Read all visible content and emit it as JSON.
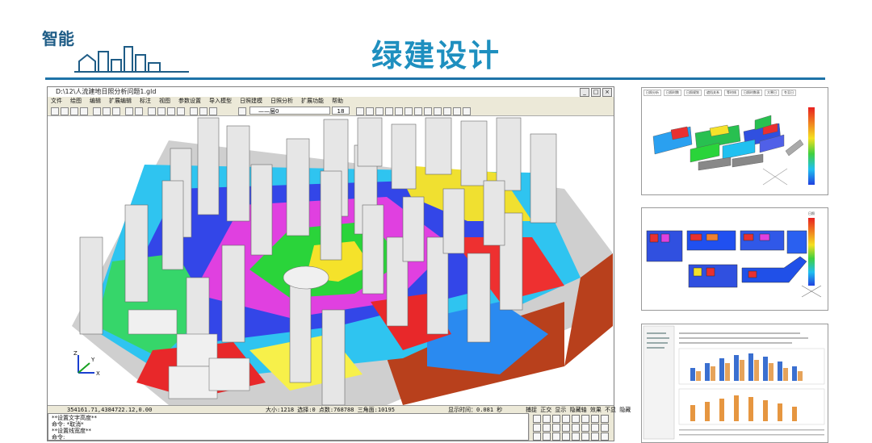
{
  "slide": {
    "title": "绿建设计",
    "logo_text": "智能"
  },
  "app": {
    "window_title": "D:\\12\\人流建地日照分析问题1.gld",
    "window_buttons": [
      "_",
      "□",
      "×"
    ],
    "menu": [
      "文件",
      "绘图",
      "编辑",
      "扩展编辑",
      "标注",
      "视图",
      "参数设置",
      "导入模型",
      "日照建模",
      "日照分析",
      "扩展功能",
      "帮助"
    ],
    "layer_combo": "——层0",
    "font_size": "18",
    "status": {
      "coords": "354161.71,4384722.12,0.00",
      "scale_info": "大小:1218 选择:0 点数:768788 三角面:10195",
      "display_time": "显示时间：0.081 秒",
      "modes": "捕捉 正交 显示 隐藏轴 效果 不显 隐藏"
    },
    "command_lines": [
      "**设置文字高度**",
      "命令: *取消*",
      "**设置线宽度**",
      "命令:"
    ],
    "axis_labels": {
      "z": "Z",
      "y": "Y",
      "x": "X"
    }
  },
  "thumbnails": [
    {
      "tabs": [
        "日照分析",
        "日照时数",
        "日照规划",
        "遮挡关系",
        "等时线",
        "日照时数表",
        "大寒日",
        "冬至日"
      ],
      "legend_title": "",
      "caption": ""
    },
    {
      "tabs": [],
      "legend_title": "日照",
      "caption": ""
    },
    {
      "tabs": [],
      "legend_title": "",
      "caption": ""
    }
  ],
  "colors": {
    "title": "#1e8fbf",
    "rule": "#1e73a8",
    "logo": "#1e5c86",
    "ground": "#b8401c"
  }
}
